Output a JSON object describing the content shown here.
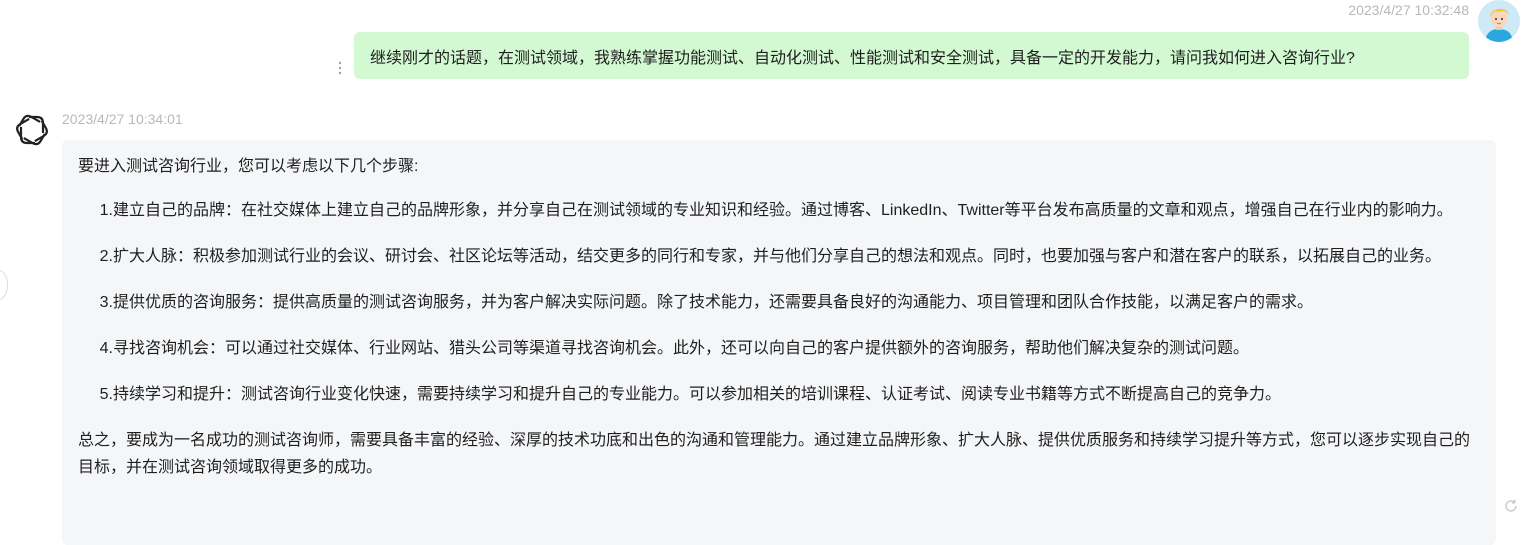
{
  "user_message": {
    "timestamp": "2023/4/27 10:32:48",
    "text": "继续刚才的话题，在测试领域，我熟练掌握功能测试、自动化测试、性能测试和安全测试，具备一定的开发能力，请问我如何进入咨询行业?"
  },
  "bot_message": {
    "timestamp": "2023/4/27 10:34:01",
    "intro": "要进入测试咨询行业，您可以考虑以下几个步骤:",
    "steps": [
      {
        "num": "1.",
        "text": "建立自己的品牌：在社交媒体上建立自己的品牌形象，并分享自己在测试领域的专业知识和经验。通过博客、LinkedIn、Twitter等平台发布高质量的文章和观点，增强自己在行业内的影响力。"
      },
      {
        "num": "2.",
        "text": "扩大人脉：积极参加测试行业的会议、研讨会、社区论坛等活动，结交更多的同行和专家，并与他们分享自己的想法和观点。同时，也要加强与客户和潜在客户的联系，以拓展自己的业务。"
      },
      {
        "num": "3.",
        "text": "提供优质的咨询服务：提供高质量的测试咨询服务，并为客户解决实际问题。除了技术能力，还需要具备良好的沟通能力、项目管理和团队合作技能，以满足客户的需求。"
      },
      {
        "num": "4.",
        "text": "寻找咨询机会：可以通过社交媒体、行业网站、猎头公司等渠道寻找咨询机会。此外，还可以向自己的客户提供额外的咨询服务，帮助他们解决复杂的测试问题。"
      },
      {
        "num": "5.",
        "text": "持续学习和提升：测试咨询行业变化快速，需要持续学习和提升自己的专业能力。可以参加相关的培训课程、认证考试、阅读专业书籍等方式不断提高自己的竞争力。"
      }
    ],
    "summary": "总之，要成为一名成功的测试咨询师，需要具备丰富的经验、深厚的技术功底和出色的沟通和管理能力。通过建立品牌形象、扩大人脉、提供优质服务和持续学习提升等方式，您可以逐步实现自己的目标，并在测试咨询领域取得更多的成功。"
  },
  "icons": {
    "user_avatar": "user-avatar",
    "bot_avatar": "openai-logo-icon",
    "more": "more-vertical-icon",
    "refresh": "refresh-icon"
  },
  "colors": {
    "user_bubble": "#d2f9d1",
    "bot_bubble": "#f4f6f8",
    "timestamp": "#b8b8b8"
  }
}
